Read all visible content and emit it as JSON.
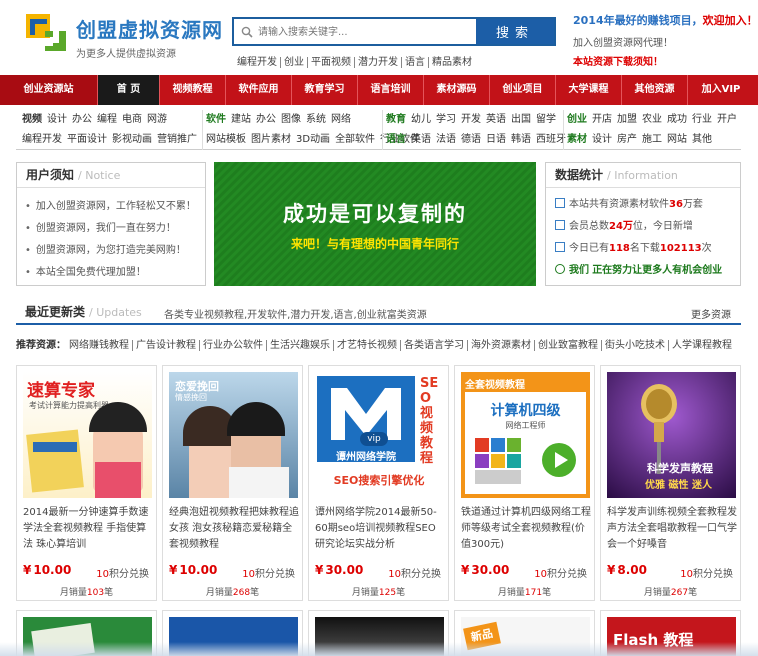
{
  "header": {
    "logo_title": "创盟虚拟资源网",
    "logo_sub": "为更多人提供虚拟资源",
    "search_placeholder": "请输入搜索关键字...",
    "search_button": "搜索",
    "hot_words": [
      "编程开发",
      "创业",
      "平面视频",
      "潜力开发",
      "语言",
      "精品素材"
    ],
    "promo_line1_prefix": "2014年最好的赚钱项目，",
    "promo_line1_highlight": "欢迎加入！",
    "promo_line2": "加入创盟资源网代理！",
    "promo_line3": "本站资源下载须知！"
  },
  "nav": [
    {
      "label": "创业资源站"
    },
    {
      "label": "首 页"
    },
    {
      "label": "视频教程"
    },
    {
      "label": "软件应用"
    },
    {
      "label": "教育学习"
    },
    {
      "label": "语言培训"
    },
    {
      "label": "素材源码"
    },
    {
      "label": "创业项目"
    },
    {
      "label": "大学课程"
    },
    {
      "label": "其他资源"
    },
    {
      "label": "加入VIP"
    }
  ],
  "subnav": [
    {
      "rows": [
        [
          "视频",
          "设计",
          "办公",
          "编程",
          "电商",
          "网游"
        ],
        [
          "编程开发",
          "平面设计",
          "影视动画",
          "营销推广"
        ]
      ]
    },
    {
      "rows": [
        [
          "软件",
          "建站",
          "办公",
          "图像",
          "系统",
          "网络"
        ],
        [
          "网站模板",
          "图片素材",
          "3D动画",
          "全部软件",
          "行业软件"
        ]
      ]
    },
    {
      "rows": [
        [
          "教育",
          "幼儿",
          "学习",
          "开发",
          "英语",
          "出国",
          "留学"
        ],
        [
          "语言",
          "英语",
          "法语",
          "德语",
          "日语",
          "韩语",
          "西班牙"
        ]
      ]
    },
    {
      "rows": [
        [
          "创业",
          "开店",
          "加盟",
          "农业",
          "成功",
          "行业",
          "开户"
        ],
        [
          "素材",
          "设计",
          "房产",
          "施工",
          "网站",
          "其他"
        ]
      ]
    }
  ],
  "notice": {
    "title": "用户须知",
    "title_en": "/ Notice",
    "items": [
      "加入创盟资源网，工作轻松又不累！",
      "创盟资源网，我们一直在努力！",
      "创盟资源网，为您打造完美网购！",
      "本站全国免费代理加盟！"
    ]
  },
  "banner": {
    "line1": "成功是可以复制的",
    "line2_a": "来吧！与有理想的中国青年同行"
  },
  "stats": {
    "title": "数据统计",
    "title_en": "/ Information",
    "line1_prefix": "本站共有资源素材软件",
    "line1_num": "36",
    "line1_suffix": "万套",
    "line2_prefix": "会员总数",
    "line2_num": "24万",
    "line2_suffix": "位，今日新增",
    "line3_prefix": "今日已有",
    "line3_num": "118",
    "line3_mid": "名下载",
    "line3_num2": "102113",
    "line3_suffix": "次",
    "line4_a": "我们",
    "line4_b": "正在努力让更多人有机会创业"
  },
  "latest": {
    "title": "最近更新类",
    "title_en": "/ Updates",
    "desc": "各类专业视频教程,开发软件,潜力开发,语言,创业就富类资源",
    "more": "更多资源"
  },
  "tags": {
    "label": "推荐资源：",
    "items": [
      "网络赚钱教程",
      "广告设计教程",
      "行业办公软件",
      "生活兴趣娱乐",
      "才艺特长视频",
      "各类语言学习",
      "海外资源素材",
      "创业致富教程",
      "街头小吃技术",
      "人学课程教程"
    ]
  },
  "products": [
    {
      "img_title": "速算专家",
      "img_sub": "考试计算能力提高利器",
      "desc": "2014最新一分钟速算手数速学法全套视频教程 手指使算法 珠心算培训",
      "price": "10.00",
      "points_num": "10",
      "points_label": "积分兑换",
      "sold_prefix": "月销量",
      "sold_num": "103",
      "sold_suffix": "笔"
    },
    {
      "img_title": "恋爱挽回",
      "img_sub": "情感挽回",
      "desc": "经典泡妞视频教程把妹教程追女孩 泡女孩秘籍恋爱秘籍全套视频教程",
      "price": "10.00",
      "points_num": "10",
      "points_label": "积分兑换",
      "sold_prefix": "月销量",
      "sold_num": "268",
      "sold_suffix": "笔"
    },
    {
      "img_title": "谭州网络学院",
      "img_side": "SEO视频教程",
      "img_bottom": "SEO搜索引擎优化",
      "img_badge": "vip",
      "desc": "谭州网络学院2014最新50-60期seo培训视频教程SEO研究论坛实战分析",
      "price": "30.00",
      "points_num": "10",
      "points_label": "积分兑换",
      "sold_prefix": "月销量",
      "sold_num": "125",
      "sold_suffix": "笔"
    },
    {
      "img_top": "全套视频教程",
      "img_title": "计算机四级",
      "img_sub": "网络工程师",
      "desc": "铁道通过计算机四级网络工程师等级考试全套视频教程(价值300元)",
      "price": "30.00",
      "points_num": "10",
      "points_label": "积分兑换",
      "sold_prefix": "月销量",
      "sold_num": "171",
      "sold_suffix": "笔"
    },
    {
      "img_title": "科学发声教程",
      "img_sub": "优雅 磁性 迷人",
      "desc": "科学发声训练视频全套教程发声方法全套唱歌教程一口气学会一个好嗓音",
      "price": "8.00",
      "points_num": "10",
      "points_label": "积分兑换",
      "sold_prefix": "月销量",
      "sold_num": "267",
      "sold_suffix": "笔"
    }
  ],
  "next_row": [
    {
      "label": ""
    },
    {
      "label": ""
    },
    {
      "label": ""
    },
    {
      "label": "新品"
    },
    {
      "label": "Flash 教程"
    }
  ],
  "colors": {
    "nav_red": "#c21218",
    "brand_blue": "#1c5ea7",
    "banner_green": "#1e7e1e",
    "price_red": "#dd0000"
  }
}
